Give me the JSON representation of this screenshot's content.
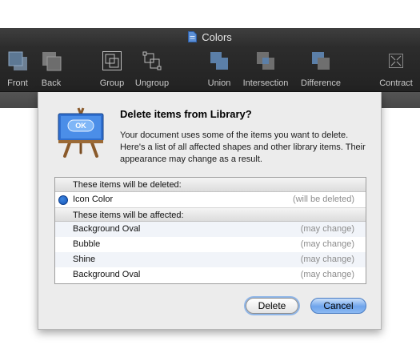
{
  "window": {
    "title": "Colors"
  },
  "toolbar": {
    "items": [
      {
        "label": "Front",
        "icon": "bring-to-front-icon"
      },
      {
        "label": "Back",
        "icon": "send-to-back-icon"
      },
      {
        "label": "Group",
        "icon": "group-icon"
      },
      {
        "label": "Ungroup",
        "icon": "ungroup-icon"
      },
      {
        "label": "Union",
        "icon": "union-icon"
      },
      {
        "label": "Intersection",
        "icon": "intersection-icon"
      },
      {
        "label": "Difference",
        "icon": "difference-icon"
      },
      {
        "label": "Contract",
        "icon": "contract-icon"
      }
    ]
  },
  "dialog": {
    "icon_button_text": "OK",
    "title": "Delete items from Library?",
    "message": "Your document uses some of the items you want to delete. Here's a list of all affected shapes and other library items. Their appearance may change as a result.",
    "deleted_header": "These items will be deleted:",
    "deleted_items": [
      {
        "name": "Icon Color",
        "status": "(will be deleted)",
        "swatch": "#1f63c6"
      }
    ],
    "affected_header": "These items will be affected:",
    "affected_items": [
      {
        "name": "Background Oval",
        "status": "(may change)"
      },
      {
        "name": "Bubble",
        "status": "(may change)"
      },
      {
        "name": "Shine",
        "status": "(may change)"
      },
      {
        "name": "Background Oval",
        "status": "(may change)"
      }
    ],
    "delete_label": "Delete",
    "cancel_label": "Cancel"
  }
}
